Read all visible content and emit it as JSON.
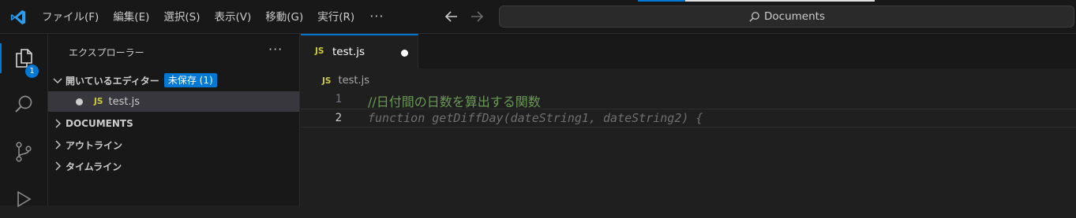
{
  "menu": {
    "items": [
      "ファイル(F)",
      "編集(E)",
      "選択(S)",
      "表示(V)",
      "移動(G)",
      "実行(R)"
    ],
    "more": "···"
  },
  "search": {
    "text": "Documents"
  },
  "activity": {
    "explorer_badge": "1"
  },
  "sidebar": {
    "title": "エクスプローラー",
    "more": "···",
    "open_editors": {
      "label": "開いているエディター",
      "badge": "未保存 (1)"
    },
    "open_file": {
      "tag": "JS",
      "name": "test.js"
    },
    "sections": [
      "DOCUMENTS",
      "アウトライン",
      "タイムライン"
    ]
  },
  "tab": {
    "tag": "JS",
    "name": "test.js"
  },
  "breadcrumb": {
    "tag": "JS",
    "name": "test.js"
  },
  "code": {
    "lines": [
      {
        "number": "1",
        "text": "//日付間の日数を算出する関数"
      },
      {
        "number": "2",
        "text": "function getDiffDay(dateString1, dateString2) {"
      }
    ]
  },
  "colors": {
    "accent": "#0078d4",
    "js_icon": "#cbcb41",
    "comment": "#6a9955"
  }
}
